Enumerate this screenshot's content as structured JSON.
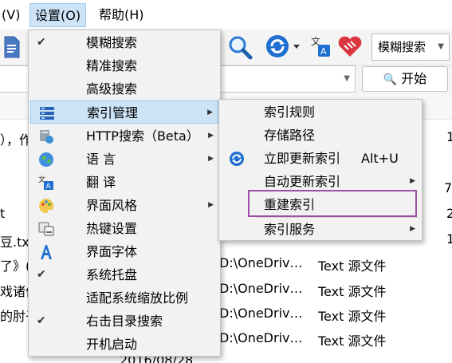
{
  "menubar": {
    "view_partial": "(V)",
    "settings": "设置(O)",
    "help": "帮助(H)"
  },
  "toolbar": {
    "icons": [
      "document-icon",
      "search-icon",
      "refresh-icon",
      "translate-icon",
      "donate-heart-icon"
    ],
    "search_mode": "模糊搜索"
  },
  "search": {
    "value": "",
    "start_label": "开始"
  },
  "bg_rows": [
    {
      "name": "），作",
      "path": "",
      "type": "",
      "extra": "1"
    },
    {
      "name": "",
      "path": "",
      "type": "",
      "extra": "7"
    },
    {
      "name": "t",
      "path": "",
      "type": "",
      "extra": "2"
    },
    {
      "name": "豆.txt",
      "path": "",
      "type": "",
      "extra": "1"
    },
    {
      "name": "了》(",
      "path": "D:\\OneDriv…",
      "type": "Text 源文件",
      "extra": ""
    },
    {
      "name": "戏诸侯",
      "path": "D:\\OneDriv…",
      "type": "Text 源文件",
      "extra": ""
    },
    {
      "name": "的肘子",
      "path": "D:\\OneDriv…",
      "type": "Text 源文件",
      "extra": ""
    },
    {
      "name": "",
      "path": "D:\\OneDriv…",
      "type": "Text 源文件",
      "extra": ""
    },
    {
      "name": "",
      "path": "2016/08/28",
      "type": "",
      "extra": ""
    }
  ],
  "settings_menu": {
    "items": [
      {
        "label": "模糊搜索",
        "checked": true,
        "submenu": false,
        "icon": ""
      },
      {
        "label": "精准搜索",
        "checked": false,
        "submenu": false,
        "icon": ""
      },
      {
        "label": "高级搜索",
        "checked": false,
        "submenu": false,
        "icon": ""
      },
      {
        "label": "索引管理",
        "checked": false,
        "submenu": true,
        "icon": "index-icon"
      },
      {
        "label": "HTTP搜索（Beta）",
        "checked": false,
        "submenu": true,
        "icon": "http-server-icon"
      },
      {
        "label": "语 言",
        "checked": false,
        "submenu": true,
        "icon": "globe-icon"
      },
      {
        "label": "翻 译",
        "checked": false,
        "submenu": false,
        "icon": "translate-icon"
      },
      {
        "label": "界面风格",
        "checked": false,
        "submenu": true,
        "icon": "palette-icon"
      },
      {
        "label": "热键设置",
        "checked": false,
        "submenu": false,
        "icon": "hotkey-icon"
      },
      {
        "label": "界面字体",
        "checked": false,
        "submenu": false,
        "icon": "font-icon"
      },
      {
        "label": "系统托盘",
        "checked": true,
        "submenu": false,
        "icon": ""
      },
      {
        "label": "适配系统缩放比例",
        "checked": false,
        "submenu": false,
        "icon": ""
      },
      {
        "label": "右击目录搜索",
        "checked": true,
        "submenu": false,
        "icon": ""
      },
      {
        "label": "开机启动",
        "checked": false,
        "submenu": false,
        "icon": ""
      }
    ]
  },
  "index_submenu": {
    "items": [
      {
        "label": "索引规则",
        "shortcut": "",
        "submenu": false
      },
      {
        "label": "存储路径",
        "shortcut": "",
        "submenu": false
      },
      {
        "label": "立即更新索引",
        "shortcut": "Alt+U",
        "submenu": false
      },
      {
        "label": "自动更新索引",
        "shortcut": "",
        "submenu": true
      },
      {
        "label": "重建索引",
        "shortcut": "",
        "submenu": false
      },
      {
        "label": "索引服务",
        "shortcut": "",
        "submenu": true
      }
    ]
  },
  "colors": {
    "highlight": "#cde4f7",
    "highlight_border": "#99c9ef",
    "annotation": "#9c4fa5",
    "heart": "#d9363e",
    "accent_blue": "#1e6fd0"
  }
}
